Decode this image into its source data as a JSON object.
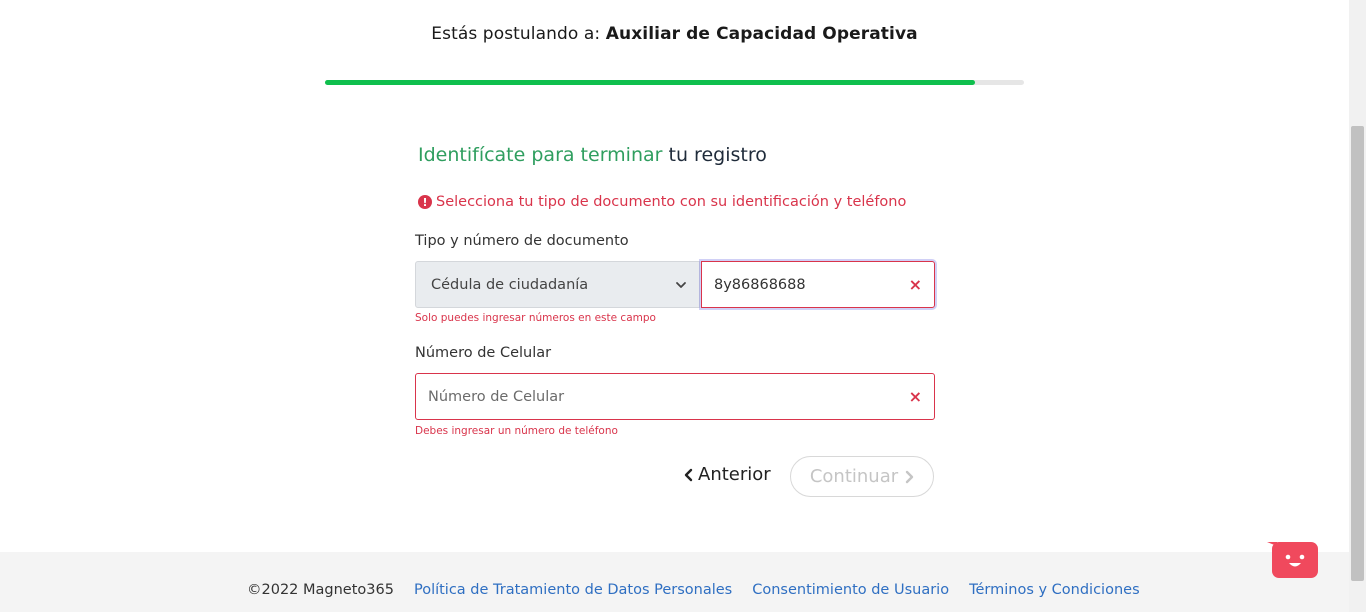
{
  "header": {
    "prefix": "Estás postulando a:",
    "job_title": "Auxiliar de Capacidad Operativa",
    "progress_fraction": 0.93
  },
  "form": {
    "heading_green": "Identifícate para terminar",
    "heading_dark": "tu registro",
    "error_message": "Selecciona tu tipo de documento con su identificación y teléfono",
    "doc_label": "Tipo y número de documento",
    "doc_type_value": "Cédula de ciudadanía",
    "doc_number_value": "8y86868688",
    "doc_error": "Solo puedes ingresar números en este campo",
    "phone_label": "Número de Celular",
    "phone_placeholder": "Número de Celular",
    "phone_error": "Debes ingresar un número de teléfono",
    "clear_symbol": "×",
    "prev_label": "Anterior",
    "next_label": "Continuar"
  },
  "footer": {
    "copyright": "©2022 Magneto365",
    "links": [
      "Política de Tratamiento de Datos Personales",
      "Consentimiento de Usuario",
      "Términos y Condiciones"
    ]
  },
  "colors": {
    "accent_green": "#0fbf4d",
    "error_red": "#d9344b",
    "link_blue": "#2f6fc2",
    "chat_red": "#f0495d"
  }
}
